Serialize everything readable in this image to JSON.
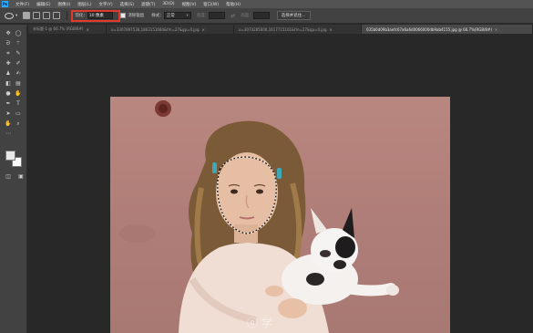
{
  "menubar": {
    "logo": "Ps",
    "items": [
      "文件(F)",
      "编辑(E)",
      "图像(I)",
      "图层(L)",
      "文字(Y)",
      "选择(S)",
      "滤镜(T)",
      "3D(D)",
      "视图(V)",
      "窗口(W)",
      "帮助(H)"
    ]
  },
  "options": {
    "feather_label": "羽化：",
    "feather_value": "10 像素",
    "antialias_label": "消除锯齿",
    "style_label": "样式：",
    "style_value": "正常",
    "width_label": "宽度：",
    "height_label": "高度：",
    "select_mask_button": "选择并遮住..."
  },
  "tabs": [
    {
      "label": "未标题-1 @ 66.7% (RGB/8#)",
      "active": false
    },
    {
      "label": "u=3307897538,1863151684&fm=27&gp=0.jpg",
      "active": false
    },
    {
      "label": "u=3074285600,1617715161&fm=27&gp=0.jpg",
      "active": false
    },
    {
      "label": "035b6d09b3aefc67a6a6d0066000db9ab4155.jpg @ 66.7%(RGB/8#)",
      "active": true
    }
  ],
  "toolbar": {
    "icons": [
      "move-icon",
      "marquee-icon",
      "lasso-icon",
      "magic-wand-icon",
      "crop-icon",
      "eyedropper-icon",
      "healing-icon",
      "brush-icon",
      "stamp-icon",
      "history-brush-icon",
      "eraser-icon",
      "gradient-icon",
      "blur-icon",
      "dodge-icon",
      "pen-icon",
      "type-icon",
      "path-select-icon",
      "rectangle-icon",
      "hand-icon",
      "zoom-icon"
    ]
  },
  "colors": {
    "feather_highlight": "#e03a2c",
    "accent": "#31a8ff"
  },
  "watermark": "ⓞ 学"
}
